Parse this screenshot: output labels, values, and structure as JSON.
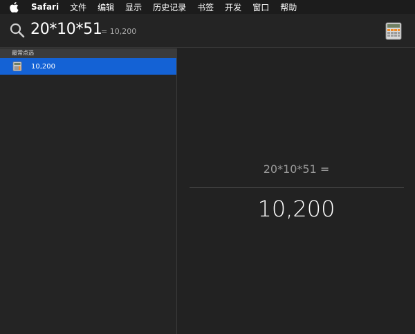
{
  "menubar": {
    "apple_icon": "apple-icon",
    "items": [
      "Safari",
      "文件",
      "编辑",
      "显示",
      "历史记录",
      "书签",
      "开发",
      "窗口",
      "帮助"
    ]
  },
  "search": {
    "query": "20*10*51",
    "inline_result": "= 10,200",
    "search_icon": "magnifier-icon",
    "app_icon": "calculator-icon"
  },
  "sidebar": {
    "section_title": "最常点选",
    "results": [
      {
        "label": "10,200",
        "icon": "calculator-icon",
        "selected": true
      }
    ]
  },
  "preview": {
    "expression": "20*10*51 =",
    "answer": "10,200"
  },
  "colors": {
    "selection": "#1462d5",
    "background": "#222222",
    "section_header": "#3b3b3b"
  }
}
